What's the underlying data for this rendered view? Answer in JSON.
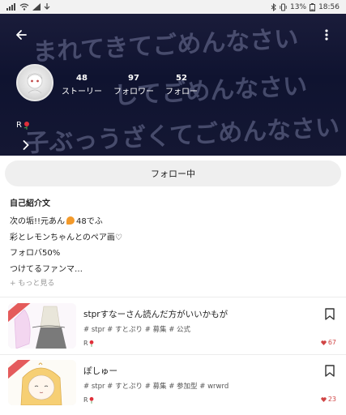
{
  "status_bar": {
    "battery_percent": "13%",
    "time": "18:56"
  },
  "profile": {
    "username": "R",
    "stats": [
      {
        "value": "48",
        "label": "ストーリー"
      },
      {
        "value": "97",
        "label": "フォロワー"
      },
      {
        "value": "52",
        "label": "フォロー"
      }
    ],
    "banner_lines": [
      "まれてきてごめんなさい",
      "してごめんなさい",
      "子ぶっうざくてごめんなさい"
    ]
  },
  "follow_button": {
    "label": "フォロー中"
  },
  "bio": {
    "title": "自己紹介文",
    "line1_before": "次の垢!!元あん",
    "line1_after": "48でふ",
    "line2": "彩とレモンちゃんとのペア画♡",
    "line3": "フォロバ50%",
    "line4": "つけてるファンマ…",
    "more": "+ もっと見る"
  },
  "stories": [
    {
      "title": "stprすなーさん読んだ方がいいかもが",
      "tags": "# stpr  # すとぷり  # 募集  # 公式",
      "author": "R",
      "likes": "67"
    },
    {
      "title": "ぽしゅー",
      "tags": "# stpr  # すとぷり  # 募集  # 参加型  # wrwrd",
      "author": "R",
      "likes": "23"
    }
  ],
  "colors": {
    "header_bg": "#141733",
    "like_red": "#d04545",
    "ribbon_red": "#e45b5b"
  }
}
